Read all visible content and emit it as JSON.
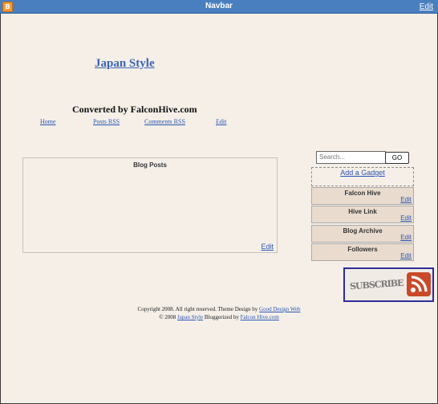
{
  "navbar": {
    "title": "Navbar",
    "edit": "Edit",
    "logo_icon": "blogger-icon"
  },
  "header": {
    "blog_title": "Japan Style",
    "converted_by": "Converted by FalconHive.com"
  },
  "top_links": [
    "Home",
    "Posts RSS",
    "Comments RSS",
    "Edit"
  ],
  "main": {
    "section_title": "Blog Posts",
    "edit": "Edit"
  },
  "search": {
    "placeholder": "Search...",
    "go_label": "GO"
  },
  "sidebar": {
    "add_gadget": "Add a Gadget",
    "gadgets": [
      {
        "title": "Falcon Hive",
        "edit": "Edit"
      },
      {
        "title": "Hive Link",
        "edit": "Edit"
      },
      {
        "title": "Blog Archive",
        "edit": "Edit"
      },
      {
        "title": "Followers",
        "edit": "Edit"
      }
    ],
    "subscribe_text": "SUBSCRIBE",
    "subscribe_icon": "rss-icon"
  },
  "footer": {
    "line1_text": "Copyright 2008. All right reserved. Theme Design by",
    "line1_link": "Good Design Web",
    "line2_prefix": "© 2008",
    "line2_link1": "Japan Style",
    "line2_mid": "Bloggerized by",
    "line2_link2": "Falcon Hive.com"
  },
  "colors": {
    "navbar": "#4a7fbf",
    "background": "#f5efe8",
    "link": "#2b57b3",
    "gadget_bg": "#e9dccf"
  }
}
